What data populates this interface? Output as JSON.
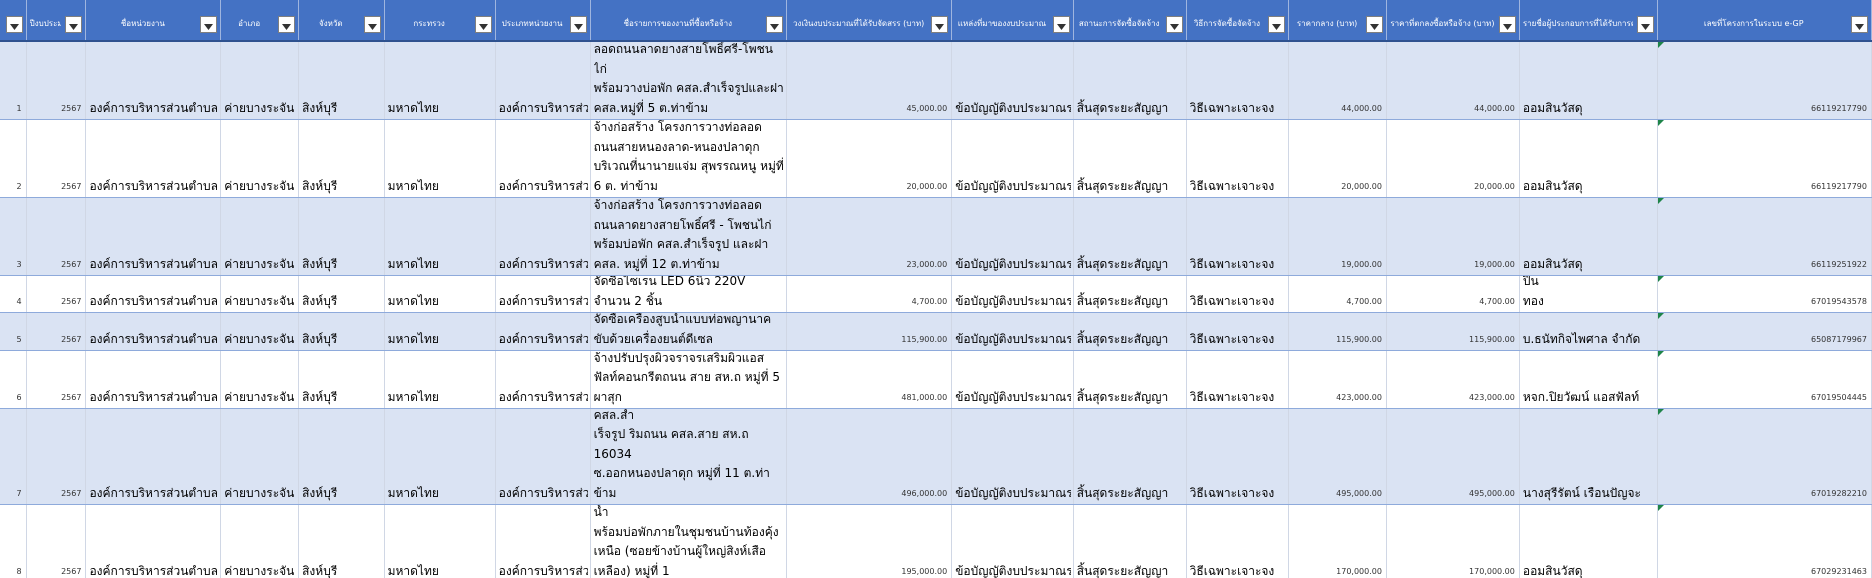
{
  "headers": [
    {
      "key": "index",
      "label": ""
    },
    {
      "key": "year",
      "label": "ปีงบประมาณ"
    },
    {
      "key": "agency",
      "label": "ชื่อหน่วยงาน"
    },
    {
      "key": "district",
      "label": "อำเภอ"
    },
    {
      "key": "province",
      "label": "จังหวัด"
    },
    {
      "key": "ministry",
      "label": "กระทรวง"
    },
    {
      "key": "agency_type",
      "label": "ประเภทหน่วยงาน"
    },
    {
      "key": "project",
      "label": "ชื่อรายการของงานที่ซื้อหรือจ้าง"
    },
    {
      "key": "budget",
      "label": "วงเงินงบประมาณที่ได้รับจัดสรร (บาท)"
    },
    {
      "key": "source",
      "label": "แหล่งที่มาของงบประมาณ"
    },
    {
      "key": "status",
      "label": "สถานะการจัดซื้อจัดจ้าง"
    },
    {
      "key": "method",
      "label": "วิธีการจัดซื้อจัดจ้าง"
    },
    {
      "key": "median_price",
      "label": "ราคากลาง (บาท)"
    },
    {
      "key": "contract_price",
      "label": "ราคาที่ตกลงซื้อหรือจ้าง (บาท)"
    },
    {
      "key": "vendor",
      "label": "รายชื่อผู้ประกอบการที่ได้รับการคัดเลือก"
    },
    {
      "key": "egp_no",
      "label": "เลขที่โครงการในระบบ e-GP"
    }
  ],
  "rows": [
    {
      "index": "1",
      "year": "2567",
      "agency": "องค์การบริหารส่วนตำบลท่าข้าม",
      "district": "ค่ายบางระจัน",
      "province": "สิงห์บุรี",
      "ministry": "มหาดไทย",
      "agency_type": "องค์การบริหารส่วนตำบล",
      "project": [
        "จ้างก่อสร้าง โครงการวางท่อระบายน้ำ",
        "ลอดถนนลาดยางสายโพธิ์ศรี-โพชนไก่",
        " พร้อมวางบ่อพัก คสล.สำเร็จรูปและฝา",
        "คสล.หมู่ที่ 5 ต.ท่าข้าม"
      ],
      "budget": "45,000.00",
      "source": "ข้อบัญญัติงบประมาณรายจ่าย",
      "status": "สิ้นสุดระยะสัญญา",
      "method": "วิธีเฉพาะเจาะจง",
      "median_price": "44,000.00",
      "contract_price": "44,000.00",
      "vendor": [
        "ออมสินวัสดุ"
      ],
      "egp_no": "66119217790"
    },
    {
      "index": "2",
      "year": "2567",
      "agency": "องค์การบริหารส่วนตำบลท่าข้าม",
      "district": "ค่ายบางระจัน",
      "province": "สิงห์บุรี",
      "ministry": "มหาดไทย",
      "agency_type": "องค์การบริหารส่วนตำบล",
      "project": [
        "จ้างก่อสร้าง โครงการวางท่อลอด",
        "ถนนสายหนองลาด-หนองปลาดุก",
        "บริเวณที่นานายแจ่ม สุพรรณหนู หมู่ที่",
        "6 ต. ท่าข้าม"
      ],
      "budget": "20,000.00",
      "source": "ข้อบัญญัติงบประมาณรายจ่าย",
      "status": "สิ้นสุดระยะสัญญา",
      "method": "วิธีเฉพาะเจาะจง",
      "median_price": "20,000.00",
      "contract_price": "20,000.00",
      "vendor": [
        "ออมสินวัสดุ"
      ],
      "egp_no": "66119217790"
    },
    {
      "index": "3",
      "year": "2567",
      "agency": "องค์การบริหารส่วนตำบลท่าข้าม",
      "district": "ค่ายบางระจัน",
      "province": "สิงห์บุรี",
      "ministry": "มหาดไทย",
      "agency_type": "องค์การบริหารส่วนตำบล",
      "project": [
        "จ้างก่อสร้าง โครงการวางท่อลอด",
        "ถนนลาดยางสายโพธิ์ศรี - โพชนไก่",
        "พร้อมบ่อพัก คสล.สำเร็จรูป และฝา",
        "คสล. หมู่ที่ 12 ต.ท่าข้าม"
      ],
      "budget": "23,000.00",
      "source": "ข้อบัญญัติงบประมาณรายจ่าย",
      "status": "สิ้นสุดระยะสัญญา",
      "method": "วิธีเฉพาะเจาะจง",
      "median_price": "19,000.00",
      "contract_price": "19,000.00",
      "vendor": [
        "ออมสินวัสดุ"
      ],
      "egp_no": "66119251922"
    },
    {
      "index": "4",
      "year": "2567",
      "agency": "องค์การบริหารส่วนตำบลท่าข้าม",
      "district": "ค่ายบางระจัน",
      "province": "สิงห์บุรี",
      "ministry": "มหาดไทย",
      "agency_type": "องค์การบริหารส่วนตำบล",
      "project": [
        "จัดซื้อไซเรน LED 6นิ้ว 220V จำนวน 2 ชิ้น"
      ],
      "budget": "4,700.00",
      "source": "ข้อบัญญัติงบประมาณรายจ่าย",
      "status": "สิ้นสุดระยะสัญญา",
      "method": "วิธีเฉพาะเจาะจง",
      "median_price": "4,700.00",
      "contract_price": "4,700.00",
      "vendor": [
        "NKC โดยนายนครินทร์ ปิ่น",
        "ทอง"
      ],
      "egp_no": "67019543578"
    },
    {
      "index": "5",
      "year": "2567",
      "agency": "องค์การบริหารส่วนตำบลท่าข้าม",
      "district": "ค่ายบางระจัน",
      "province": "สิงห์บุรี",
      "ministry": "มหาดไทย",
      "agency_type": "องค์การบริหารส่วนตำบล",
      "project": [
        "จัดซื้อเครื่องสูบน้ำแบบท่อพญานาค",
        "ขับด้วยเครื่องยนต์ดีเซล"
      ],
      "budget": "115,900.00",
      "source": "ข้อบัญญัติงบประมาณรายจ่าย",
      "status": "สิ้นสุดระยะสัญญา",
      "method": "วิธีเฉพาะเจาะจง",
      "median_price": "115,900.00",
      "contract_price": "115,900.00",
      "vendor": [
        "บ.ธนัทกิจไพศาล จำกัด"
      ],
      "egp_no": "65087179967"
    },
    {
      "index": "6",
      "year": "2567",
      "agency": "องค์การบริหารส่วนตำบลท่าข้าม",
      "district": "ค่ายบางระจัน",
      "province": "สิงห์บุรี",
      "ministry": "มหาดไทย",
      "agency_type": "องค์การบริหารส่วนตำบล",
      "project": [
        "จ้างปรับปรุงผิวจราจรเสริมผิวแอส",
        "ฟัลท์คอนกรีตถนน สาย สห.ถ หมู่ที่ 5",
        "ผาสุก"
      ],
      "budget": "481,000.00",
      "source": "ข้อบัญญัติงบประมาณรายจ่าย",
      "status": "สิ้นสุดระยะสัญญา",
      "method": "วิธีเฉพาะเจาะจง",
      "median_price": "423,000.00",
      "contract_price": "423,000.00",
      "vendor": [
        "หจก.ปิยวัฒน์ แอสฟัลท์"
      ],
      "egp_no": "67019504445"
    },
    {
      "index": "7",
      "year": "2567",
      "agency": "องค์การบริหารส่วนตำบลท่าข้าม",
      "district": "ค่ายบางระจัน",
      "province": "สิงห์บุรี",
      "ministry": "มหาดไทย",
      "agency_type": "องค์การบริหารส่วนตำบล",
      "project": [
        "จ้างก่อสร้าง โครงการวางท่อส่งน้ำ",
        "บริเวณคู่ส่งน้ำพร้อมวางบ่อพัก คสล.สำ",
        "เร็จรูป ริมถนน คสล.สาย สห.ถ 16034",
        "ซ.ออกหนองปลาดุก หมู่ที่ 11 ต.ท่าข้าม"
      ],
      "budget": "496,000.00",
      "source": "ข้อบัญญัติงบประมาณรายจ่าย",
      "status": "สิ้นสุดระยะสัญญา",
      "method": "วิธีเฉพาะเจาะจง",
      "median_price": "495,000.00",
      "contract_price": "495,000.00",
      "vendor": [
        "นางสุรีรัตน์ เรือนปัญจะ"
      ],
      "egp_no": "67019282210"
    },
    {
      "index": "8",
      "year": "2567",
      "agency": "องค์การบริหารส่วนตำบลท่าข้าม",
      "district": "ค่ายบางระจัน",
      "province": "สิงห์บุรี",
      "ministry": "มหาดไทย",
      "agency_type": "องค์การบริหารส่วนตำบล",
      "project": [
        "จ้างก่อสร้าง โครงการวางท่อระบายน้ำ",
        "พร้อมบ่อพักภายในชุมชนบ้านท้องคุ้ง",
        "เหนือ (ซอยข้างบ้านผู้ใหญ่สิงห์เสือ",
        "เหลือง) หมู่ที่ 1"
      ],
      "budget": "195,000.00",
      "source": "ข้อบัญญัติงบประมาณรายจ่าย",
      "status": "สิ้นสุดระยะสัญญา",
      "method": "วิธีเฉพาะเจาะจง",
      "median_price": "170,000.00",
      "contract_price": "170,000.00",
      "vendor": [
        "ออมสินวัสดุ"
      ],
      "egp_no": "67029231463"
    }
  ]
}
